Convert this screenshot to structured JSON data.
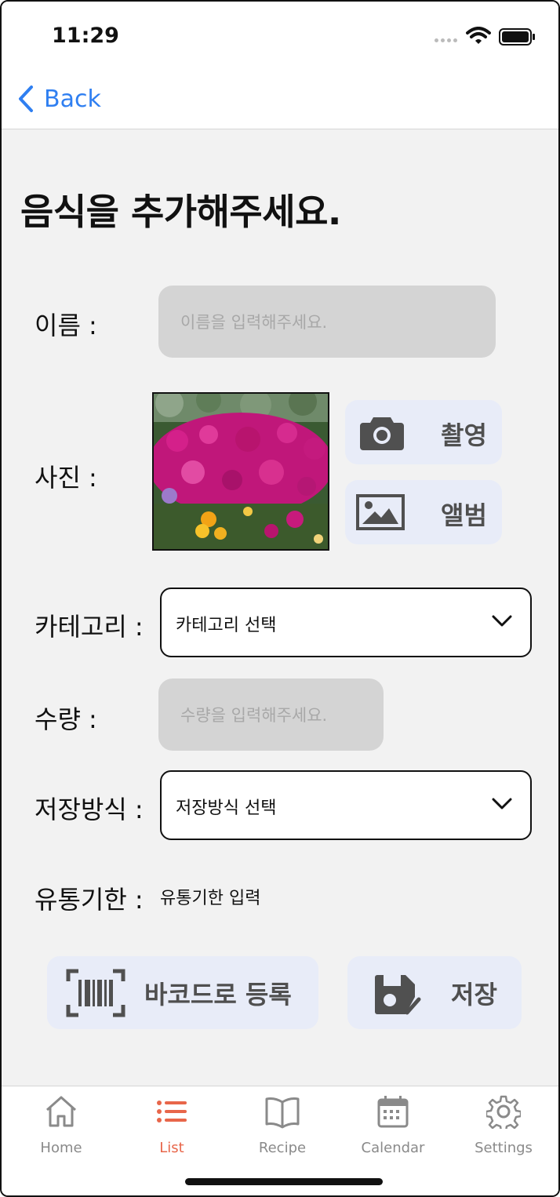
{
  "status_bar": {
    "time": "11:29"
  },
  "nav": {
    "back_label": "Back"
  },
  "page": {
    "title": "음식을 추가해주세요."
  },
  "form": {
    "name": {
      "label": "이름 :",
      "placeholder": "이름을 입력해주세요."
    },
    "photo": {
      "label": "사진 :",
      "camera_label": "촬영",
      "album_label": "앨범"
    },
    "category": {
      "label": "카테고리 :",
      "value": "카테고리 선택"
    },
    "quantity": {
      "label": "수량 :",
      "placeholder": "수량을 입력해주세요."
    },
    "storage": {
      "label": "저장방식 :",
      "value": "저장방식 선택"
    },
    "expiry": {
      "label": "유통기한 :",
      "value": "유통기한 입력"
    }
  },
  "actions": {
    "barcode_label": "바코드로 등록",
    "save_label": "저장"
  },
  "tabs": [
    {
      "label": "Home",
      "icon": "home-icon",
      "active": false
    },
    {
      "label": "List",
      "icon": "list-icon",
      "active": true
    },
    {
      "label": "Recipe",
      "icon": "book-icon",
      "active": false
    },
    {
      "label": "Calendar",
      "icon": "calendar-icon",
      "active": false
    },
    {
      "label": "Settings",
      "icon": "gear-icon",
      "active": false
    }
  ],
  "colors": {
    "accent": "#2f7ff1",
    "active_tab": "#e8664a",
    "field_bg": "#d4d4d4",
    "soft_button_bg": "#e8ecf8"
  }
}
